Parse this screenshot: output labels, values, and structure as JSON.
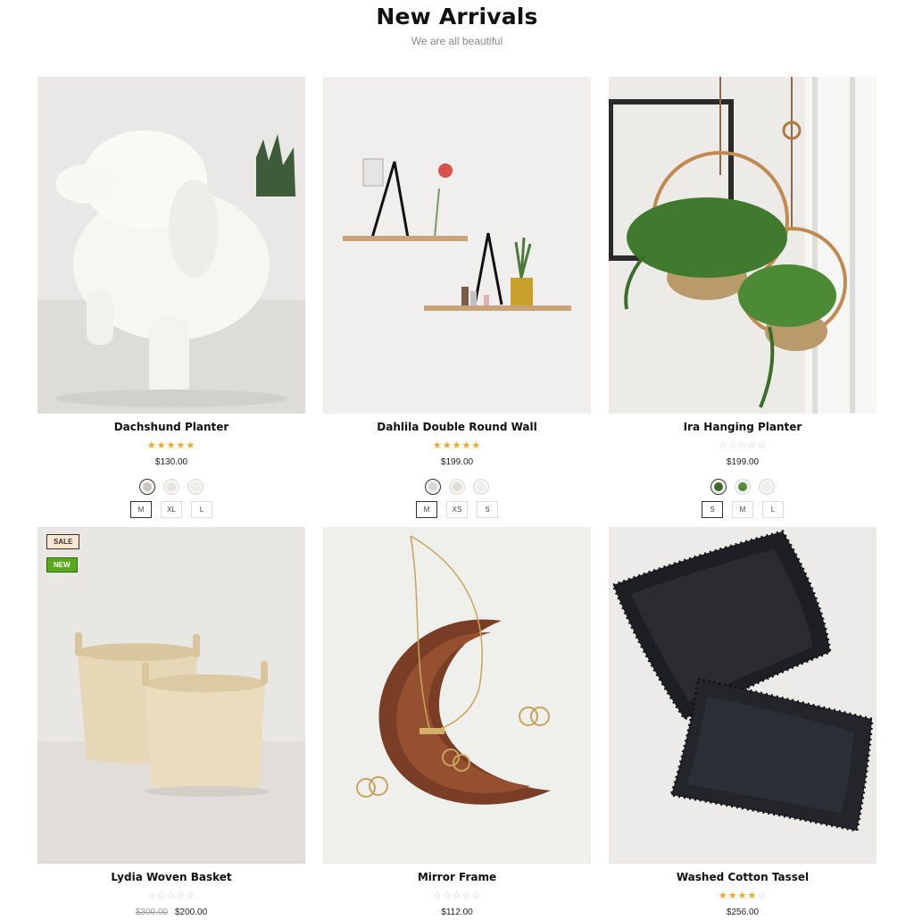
{
  "section": {
    "title": "New Arrivals",
    "subtitle": "We are all beautiful"
  },
  "products": [
    {
      "name": "Dachshund Planter",
      "rating": 5,
      "price": "$130.00",
      "swatches": [
        "#c9c6c0",
        "#e9e5dd",
        "#eeece7"
      ],
      "sizes": [
        "M",
        "XL",
        "L"
      ],
      "selected_size": "M",
      "image": "ceramic-dog-planter"
    },
    {
      "name": "Dahlila Double Round Wall",
      "rating": 5,
      "price": "$199.00",
      "swatches": [
        "#d8d8d8",
        "#e2ddd2",
        "#eeeeee"
      ],
      "sizes": [
        "M",
        "XS",
        "S"
      ],
      "selected_size": "M",
      "image": "wall-shelves"
    },
    {
      "name": "Ira Hanging Planter",
      "rating": 0,
      "price": "$199.00",
      "swatches": [
        "#3f6b2a",
        "#5b8a3a",
        "#f0eeea"
      ],
      "sizes": [
        "S",
        "M",
        "L"
      ],
      "selected_size": "S",
      "image": "hanging-fern-planters"
    },
    {
      "name": "Lydia Woven Basket",
      "rating": 0,
      "price_old": "$300.00",
      "price": "$200.00",
      "badges": {
        "sale": "SALE",
        "new": "NEW"
      },
      "image": "woven-baskets"
    },
    {
      "name": "Mirror Frame",
      "rating": 0,
      "price": "$112.00",
      "image": "wooden-moon-tray"
    },
    {
      "name": "Washed Cotton Tassel",
      "rating": 4,
      "price": "$256.00",
      "image": "black-tassel-pillows"
    }
  ],
  "colors": {
    "star_on": "#f5a623",
    "star_off": "#cfcfcf",
    "new_badge": "#59a81c",
    "sale_badge": "#fde6cf"
  }
}
